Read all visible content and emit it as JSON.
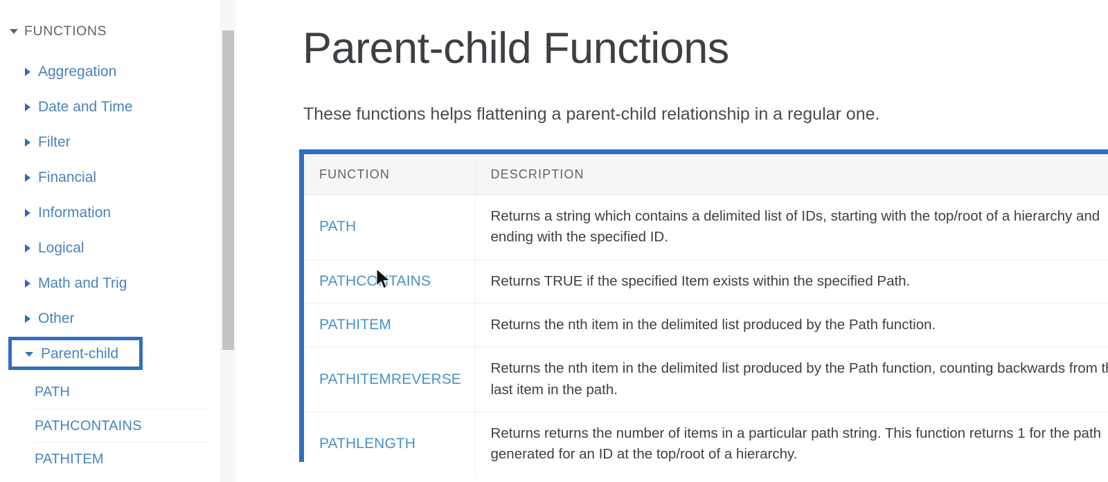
{
  "sidebar": {
    "section": {
      "label": "FUNCTIONS",
      "caret_icon": "caret-down-icon"
    },
    "items": [
      {
        "label": "Aggregation",
        "caret_icon": "caret-right-icon",
        "expanded": false
      },
      {
        "label": "Date and Time",
        "caret_icon": "caret-right-icon",
        "expanded": false
      },
      {
        "label": "Filter",
        "caret_icon": "caret-right-icon",
        "expanded": false
      },
      {
        "label": "Financial",
        "caret_icon": "caret-right-icon",
        "expanded": false
      },
      {
        "label": "Information",
        "caret_icon": "caret-right-icon",
        "expanded": false
      },
      {
        "label": "Logical",
        "caret_icon": "caret-right-icon",
        "expanded": false
      },
      {
        "label": "Math and Trig",
        "caret_icon": "caret-right-icon",
        "expanded": false
      },
      {
        "label": "Other",
        "caret_icon": "caret-right-icon",
        "expanded": false
      },
      {
        "label": "Parent-child",
        "caret_icon": "caret-down-icon",
        "expanded": true
      }
    ],
    "sub_items": [
      {
        "label": "PATH"
      },
      {
        "label": "PATHCONTAINS"
      },
      {
        "label": "PATHITEM"
      }
    ],
    "highlight_color": "#2f6fc4",
    "link_color": "#4a82bd",
    "scrollbar": {
      "track_color": "#f7f7f7",
      "thumb_color": "#c4c4c4"
    }
  },
  "main": {
    "title": "Parent-child Functions",
    "intro": "These functions helps flattening a parent-child relationship in a regular one.",
    "highlight_color": "#2f6fc4",
    "table": {
      "headers": [
        "FUNCTION",
        "DESCRIPTION"
      ],
      "rows": [
        {
          "function": "PATH",
          "description": "Returns a string which contains a delimited list of IDs, starting with the top/root of a hierarchy and ending with the specified ID."
        },
        {
          "function": "PATHCONTAINS",
          "description": "Returns TRUE if the specified Item exists within the specified Path."
        },
        {
          "function": "PATHITEM",
          "description": "Returns the nth item in the delimited list produced by the Path function."
        },
        {
          "function": "PATHITEMREVERSE",
          "description": "Returns the nth item in the delimited list produced by the Path function, counting backwards from the last item in the path."
        },
        {
          "function": "PATHLENGTH",
          "description": "Returns returns the number of items in a particular path string. This function returns 1 for the path generated for an ID at the top/root of a hierarchy."
        }
      ]
    }
  },
  "cursor": {
    "icon": "mouse-pointer-icon"
  }
}
